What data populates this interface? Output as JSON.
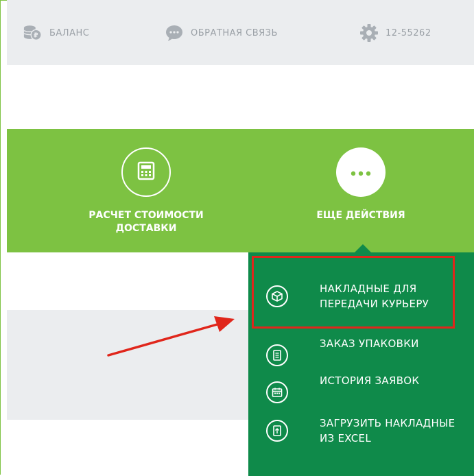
{
  "topbar": {
    "balance_label": "БАЛАНС",
    "feedback_label": "ОБРАТНАЯ СВЯЗЬ",
    "account_id": "12-55262"
  },
  "actions": {
    "calc_label": "РАСЧЕТ СТОИМОСТИ ДОСТАВКИ",
    "more_label": "ЕЩЕ ДЕЙСТВИЯ"
  },
  "menu": {
    "items": [
      {
        "label": "НАКЛАДНЫЕ ДЛЯ ПЕРЕДАЧИ КУРЬЕРУ",
        "icon": "box-icon"
      },
      {
        "label": "ЗАКАЗ УПАКОВКИ",
        "icon": "document-icon"
      },
      {
        "label": "ИСТОРИЯ ЗАЯВОК",
        "icon": "calendar-icon"
      },
      {
        "label": "ЗАГРУЗИТЬ НАКЛАДНЫЕ ИЗ EXCEL",
        "icon": "upload-file-icon"
      }
    ]
  },
  "colors": {
    "accent_green": "#7dc242",
    "menu_green": "#0f8a4a",
    "highlight_red": "#e0261b",
    "topbar_gray": "#ebedef"
  }
}
